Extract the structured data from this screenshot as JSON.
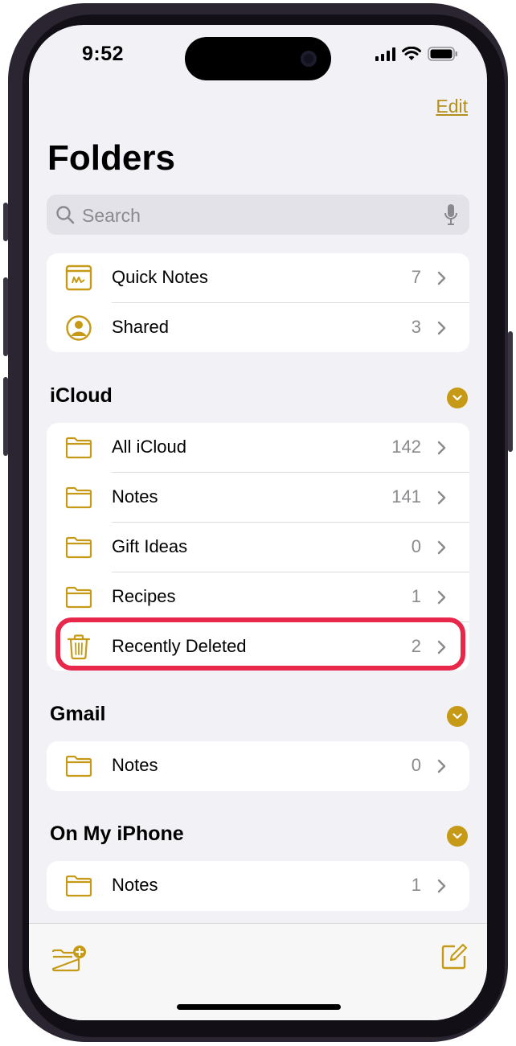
{
  "status_bar": {
    "time": "9:52"
  },
  "header": {
    "edit_label": "Edit",
    "title": "Folders"
  },
  "search": {
    "placeholder": "Search"
  },
  "top_group": [
    {
      "icon": "quick-notes-icon",
      "label": "Quick Notes",
      "count": "7"
    },
    {
      "icon": "shared-person-icon",
      "label": "Shared",
      "count": "3"
    }
  ],
  "sections": {
    "icloud": {
      "title": "iCloud",
      "items": [
        {
          "icon": "folder-icon",
          "label": "All iCloud",
          "count": "142"
        },
        {
          "icon": "folder-icon",
          "label": "Notes",
          "count": "141"
        },
        {
          "icon": "folder-icon",
          "label": "Gift Ideas",
          "count": "0"
        },
        {
          "icon": "folder-icon",
          "label": "Recipes",
          "count": "1"
        },
        {
          "icon": "trash-icon",
          "label": "Recently Deleted",
          "count": "2"
        }
      ]
    },
    "gmail": {
      "title": "Gmail",
      "items": [
        {
          "icon": "folder-icon",
          "label": "Notes",
          "count": "0"
        }
      ]
    },
    "on_my_iphone": {
      "title": "On My iPhone",
      "items": [
        {
          "icon": "folder-icon",
          "label": "Notes",
          "count": "1"
        }
      ]
    }
  },
  "toolbar": {
    "left_icon": "new-folder-icon",
    "right_icon": "compose-icon"
  },
  "colors": {
    "accent": "#c69a16",
    "highlight": "#e8284a",
    "background": "#f2f1f6"
  }
}
